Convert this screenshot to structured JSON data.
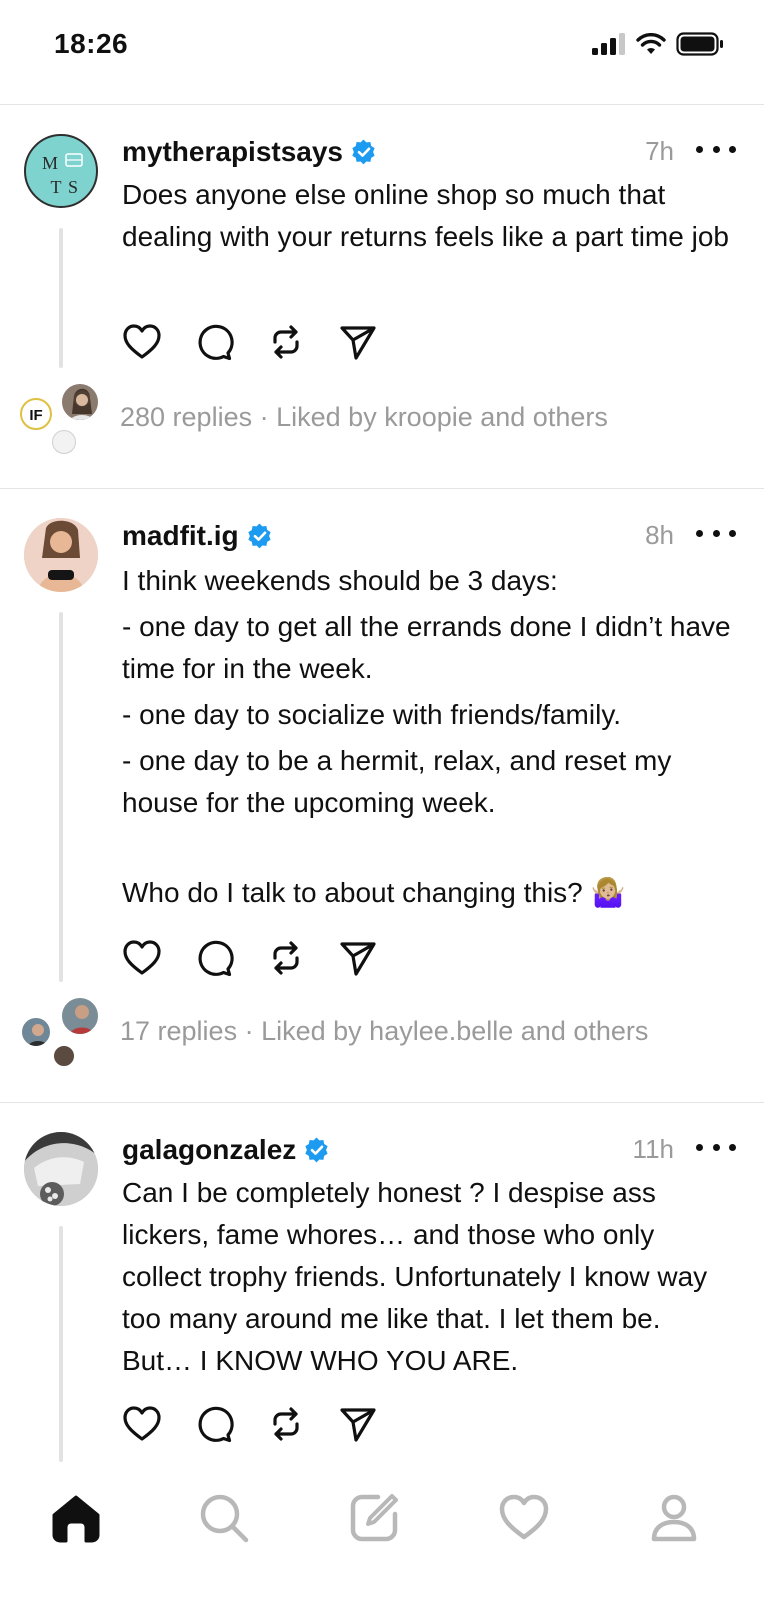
{
  "status_bar": {
    "time": "18:26"
  },
  "posts": [
    {
      "username": "mytherapistsays",
      "verified": true,
      "time": "7h",
      "text": "Does anyone else online shop so much that dealing with your returns feels like a part time job",
      "avatar_letters": [
        "M",
        "T",
        "S"
      ],
      "replies": "280 replies",
      "separator": "·",
      "liked_by": "Liked by kroopie and others",
      "mini_avatar_letter": "IF"
    },
    {
      "username": "madfit.ig",
      "verified": true,
      "time": "8h",
      "lines": [
        "I think weekends should be 3 days:",
        "- one day to get all the errands done I didn’t have time for in the week.",
        "- one day to socialize with friends/family.",
        "- one day to be a hermit, relax, and reset my house for the upcoming week.",
        "Who do I talk to about changing this? 🤷🏼‍♀️"
      ],
      "replies": "17 replies",
      "separator": "·",
      "liked_by": "Liked by haylee.belle and others"
    },
    {
      "username": "galagonzalez",
      "verified": true,
      "time": "11h",
      "text": "Can I be completely honest ? I despise ass lickers, fame whores… and those who only collect trophy friends. Unfortunately I know way too many around me like that. I let them be. But… I KNOW WHO YOU ARE."
    }
  ],
  "colors": {
    "verified": "#1d9bf0",
    "muted": "#9a9a9a",
    "divider": "#e4e4e4",
    "mts_avatar": "#7fd3cf"
  },
  "tab_bar": {
    "items": [
      "home-icon",
      "search-icon",
      "compose-icon",
      "activity-heart-icon",
      "profile-icon"
    ],
    "active": "home-icon"
  }
}
